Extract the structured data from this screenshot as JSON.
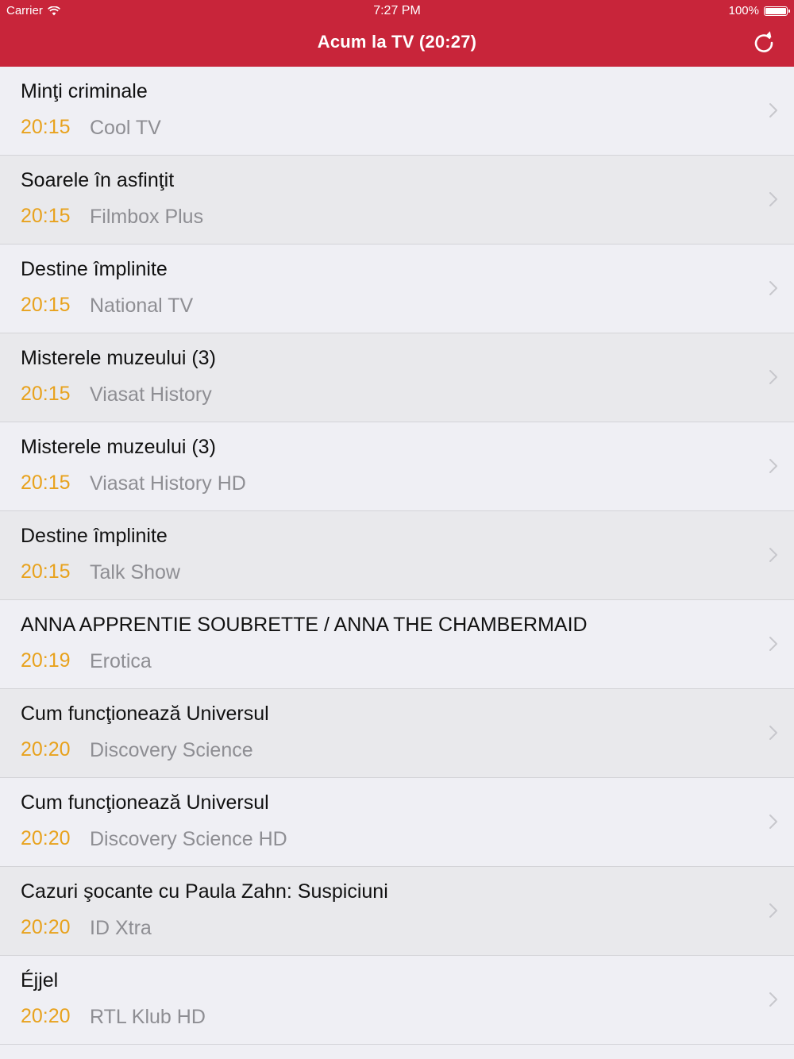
{
  "status_bar": {
    "carrier": "Carrier",
    "wifi_icon": "wifi-icon",
    "time": "7:27 PM",
    "battery_percent": "100%",
    "battery_level": 1.0
  },
  "nav": {
    "title": "Acum la TV (20:27)",
    "refresh_icon": "refresh-icon"
  },
  "colors": {
    "header": "#c8253a",
    "time_accent": "#e8a21d",
    "channel_text": "#8e8e93"
  },
  "programs": [
    {
      "title": "Minţi criminale",
      "time": "20:15",
      "channel": "Cool TV"
    },
    {
      "title": "Soarele în asfinţit",
      "time": "20:15",
      "channel": "Filmbox Plus"
    },
    {
      "title": "Destine împlinite",
      "time": "20:15",
      "channel": "National TV"
    },
    {
      "title": "Misterele muzeului (3)",
      "time": "20:15",
      "channel": "Viasat History"
    },
    {
      "title": "Misterele muzeului (3)",
      "time": "20:15",
      "channel": "Viasat History HD"
    },
    {
      "title": "Destine împlinite",
      "time": "20:15",
      "channel": "Talk Show"
    },
    {
      "title": "ANNA APPRENTIE SOUBRETTE / ANNA THE CHAMBERMAID",
      "time": "20:19",
      "channel": "Erotica"
    },
    {
      "title": "Cum funcţionează Universul",
      "time": "20:20",
      "channel": "Discovery Science"
    },
    {
      "title": "Cum funcţionează Universul",
      "time": "20:20",
      "channel": "Discovery Science HD"
    },
    {
      "title": "Cazuri şocante cu Paula Zahn: Suspiciuni",
      "time": "20:20",
      "channel": "ID Xtra"
    },
    {
      "title": "Éjjel",
      "time": "20:20",
      "channel": "RTL Klub HD"
    }
  ]
}
